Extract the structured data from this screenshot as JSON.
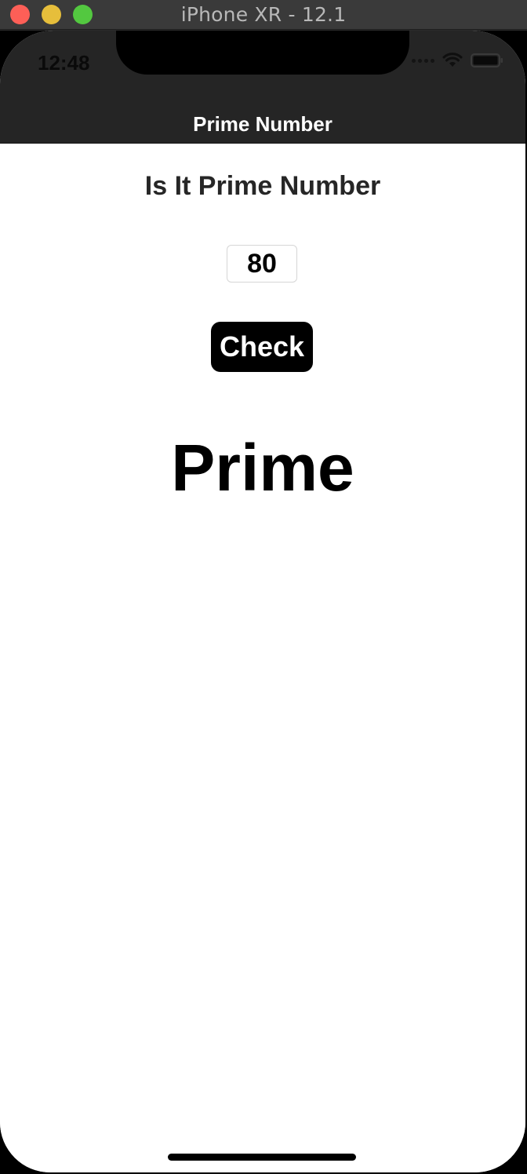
{
  "window": {
    "title": "iPhone XR - 12.1"
  },
  "status_bar": {
    "time": "12:48",
    "icons": [
      "cellular-dots-icon",
      "wifi-icon",
      "battery-icon"
    ]
  },
  "nav_bar": {
    "title": "Prime Number"
  },
  "main": {
    "heading": "Is It Prime Number",
    "number_input": {
      "value": "80"
    },
    "check_button": "Check",
    "result": "Prime"
  },
  "colors": {
    "nav_background": "#252525",
    "button_background": "#000000",
    "traffic_close": "#fd5f57",
    "traffic_minimize": "#e6be3b",
    "traffic_maximize": "#53c840"
  }
}
